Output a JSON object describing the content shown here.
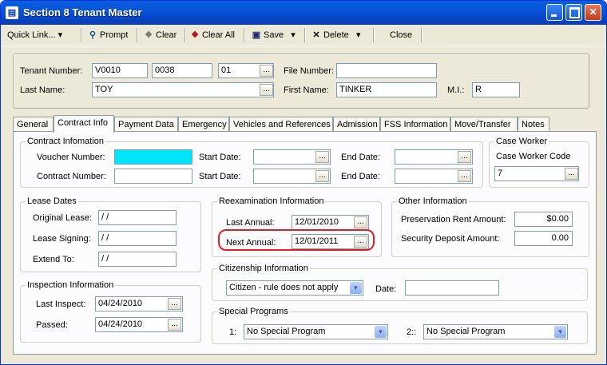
{
  "window": {
    "title": "Section 8 Tenant Master",
    "icon": "app-icon"
  },
  "toolbar": {
    "quick_link": "Quick Link...",
    "prompt": "Prompt",
    "clear": "Clear",
    "clear_all": "Clear All",
    "save": "Save",
    "delete": "Delete",
    "close": "Close"
  },
  "header": {
    "tenant_number_label": "Tenant Number:",
    "tenant_number_1": "V0010",
    "tenant_number_2": "0038",
    "tenant_number_3": "01",
    "file_number_label": "File Number:",
    "file_number": "",
    "last_name_label": "Last Name:",
    "last_name": "TOY",
    "first_name_label": "First Name:",
    "first_name": "TINKER",
    "mi_label": "M.I.:",
    "mi": "R"
  },
  "tabs": [
    "General",
    "Contract Info",
    "Payment Data",
    "Emergency",
    "Vehicles and References",
    "Admission",
    "FSS Information",
    "Move/Transfer",
    "Notes"
  ],
  "active_tab": "Contract Info",
  "contract": {
    "legend": "Contract Infomation",
    "voucher_label": "Voucher Number:",
    "voucher": "",
    "contract_label": "Contract Number:",
    "contract": "",
    "start_label": "Start Date:",
    "end_label": "End Date:",
    "start1": "",
    "end1": "",
    "start2": "",
    "end2": ""
  },
  "case_worker": {
    "legend": "Case Worker",
    "code_label": "Case Worker Code",
    "code": "7"
  },
  "lease": {
    "legend": "Lease Dates",
    "original_label": "Original Lease:",
    "original": " / /",
    "signing_label": "Lease Signing:",
    "signing": " / /",
    "extend_label": "Extend To:",
    "extend": " / /"
  },
  "reexam": {
    "legend": "Reexamination Information",
    "last_label": "Last Annual:",
    "last": "12/01/2010",
    "next_label": "Next Annual:",
    "next": "12/01/2011"
  },
  "other": {
    "legend": "Other Information",
    "pres_label": "Preservation Rent Amount:",
    "pres": "$0.00",
    "deposit_label": "Security Deposit Amount:",
    "deposit": "0.00"
  },
  "inspection": {
    "legend": "Inspection Information",
    "last_label": "Last Inspect:",
    "last": "04/24/2010",
    "passed_label": "Passed:",
    "passed": "04/24/2010"
  },
  "citizenship": {
    "legend": "Citizenship Information",
    "status": "Citizen - rule does not apply",
    "date_label": "Date:",
    "date": ""
  },
  "special": {
    "legend": "Special Programs",
    "p1_label": "1:",
    "p1": "No Special Program",
    "p2_label": "2::",
    "p2": "No Special Program"
  },
  "colors": {
    "voucher_highlight": "#00e5ff",
    "annotation": "#e02020",
    "title_bar": "#0854d8"
  }
}
